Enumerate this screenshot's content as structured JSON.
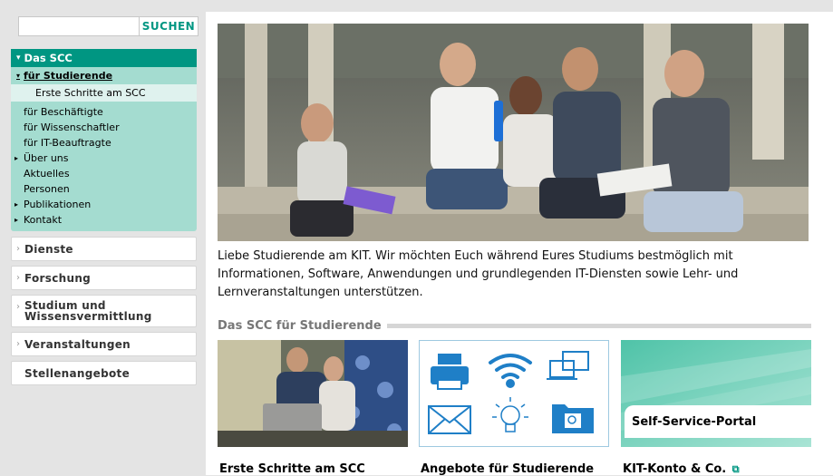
{
  "search": {
    "value": "",
    "button": "SUCHEN"
  },
  "nav": {
    "head": "Das SCC",
    "sub": "für Studierende",
    "active": "Erste Schritte am SCC",
    "items": [
      {
        "label": "für Beschäftigte",
        "arrow": false
      },
      {
        "label": "für Wissenschaftler",
        "arrow": false
      },
      {
        "label": "für IT-Beauftragte",
        "arrow": false
      },
      {
        "label": "Über uns",
        "arrow": true
      },
      {
        "label": "Aktuelles",
        "arrow": false
      },
      {
        "label": "Personen",
        "arrow": false
      },
      {
        "label": "Publikationen",
        "arrow": true
      },
      {
        "label": "Kontakt",
        "arrow": true
      }
    ]
  },
  "side": {
    "dienste": "Dienste",
    "forschung": "Forschung",
    "studium": "Studium und Wissensvermittlung",
    "veranstaltungen": "Veranstaltungen",
    "stellen": "Stellenangebote"
  },
  "main": {
    "intro": "Liebe Studierende am KIT. Wir möchten Euch während Eures Studiums bestmöglich mit Informationen, Software, Anwendungen und grundlegenden IT-Diensten sowie Lehr- und Lernveranstaltungen unterstützen.",
    "section_title": "Das SCC für Studierende",
    "tiles": [
      {
        "caption": "Erste Schritte am SCC"
      },
      {
        "caption": "Angebote für Studierende"
      },
      {
        "caption": "KIT-Konto & Co.",
        "label": "Self-Service-Portal"
      }
    ]
  },
  "colors": {
    "accent": "#009682",
    "nav_bg": "#a4dcd0",
    "active_bg": "#dff2ee"
  },
  "icons": [
    "printer-icon",
    "wifi-icon",
    "computer-icon",
    "mail-icon",
    "lightbulb-icon",
    "folder-search-icon",
    "external-link-icon"
  ]
}
